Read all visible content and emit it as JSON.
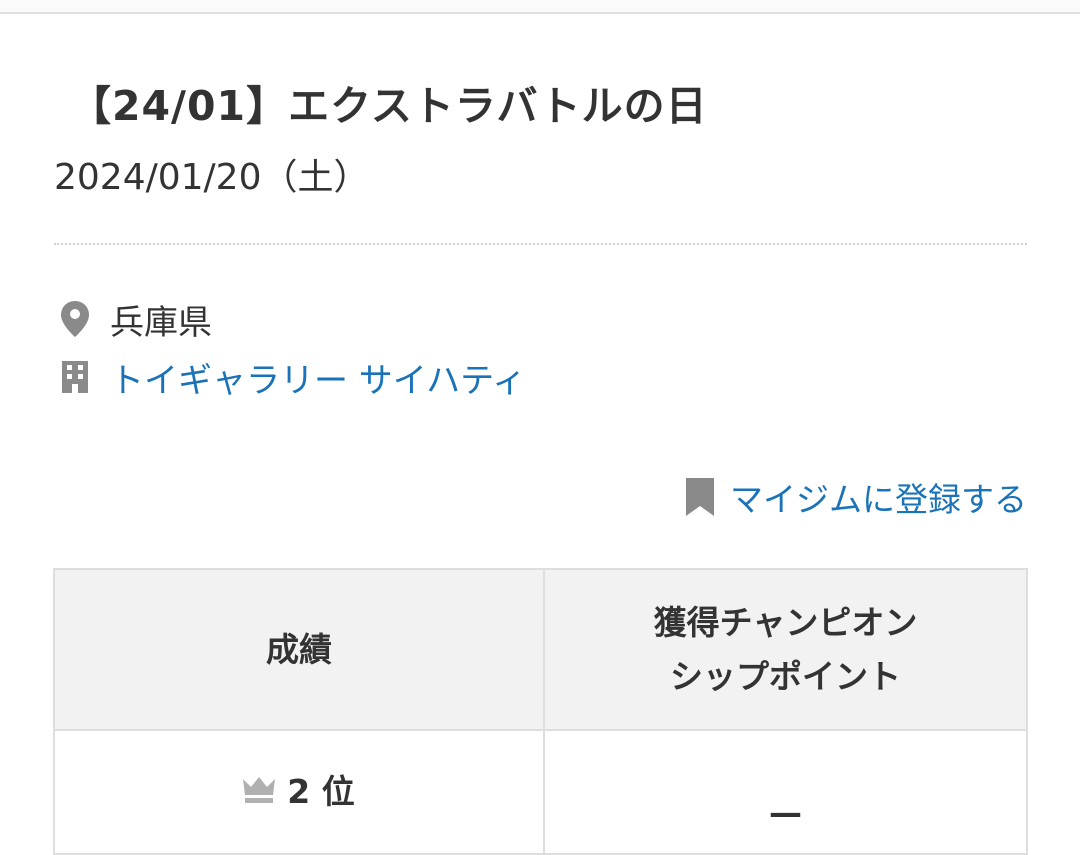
{
  "event": {
    "title": "【24/01】エクストラバトルの日",
    "date": "2024/01/20（土）"
  },
  "location": {
    "prefecture": "兵庫県",
    "prefecture_icon": "map-pin-icon",
    "venue": "トイギャラリー サイハティ",
    "venue_icon": "building-icon"
  },
  "actions": {
    "register_mygym": "マイジムに登録する",
    "register_icon": "bookmark-icon"
  },
  "results_table": {
    "headers": {
      "result": "成績",
      "points_line1": "獲得チャンピオン",
      "points_line2": "シップポイント"
    },
    "rows": [
      {
        "rank": "2 位",
        "rank_icon": "crown-icon",
        "points": "—"
      }
    ]
  },
  "colors": {
    "link": "#1a73b8",
    "text": "#333333",
    "icon_gray": "#8a8a8a",
    "header_bg": "#f2f2f2"
  }
}
